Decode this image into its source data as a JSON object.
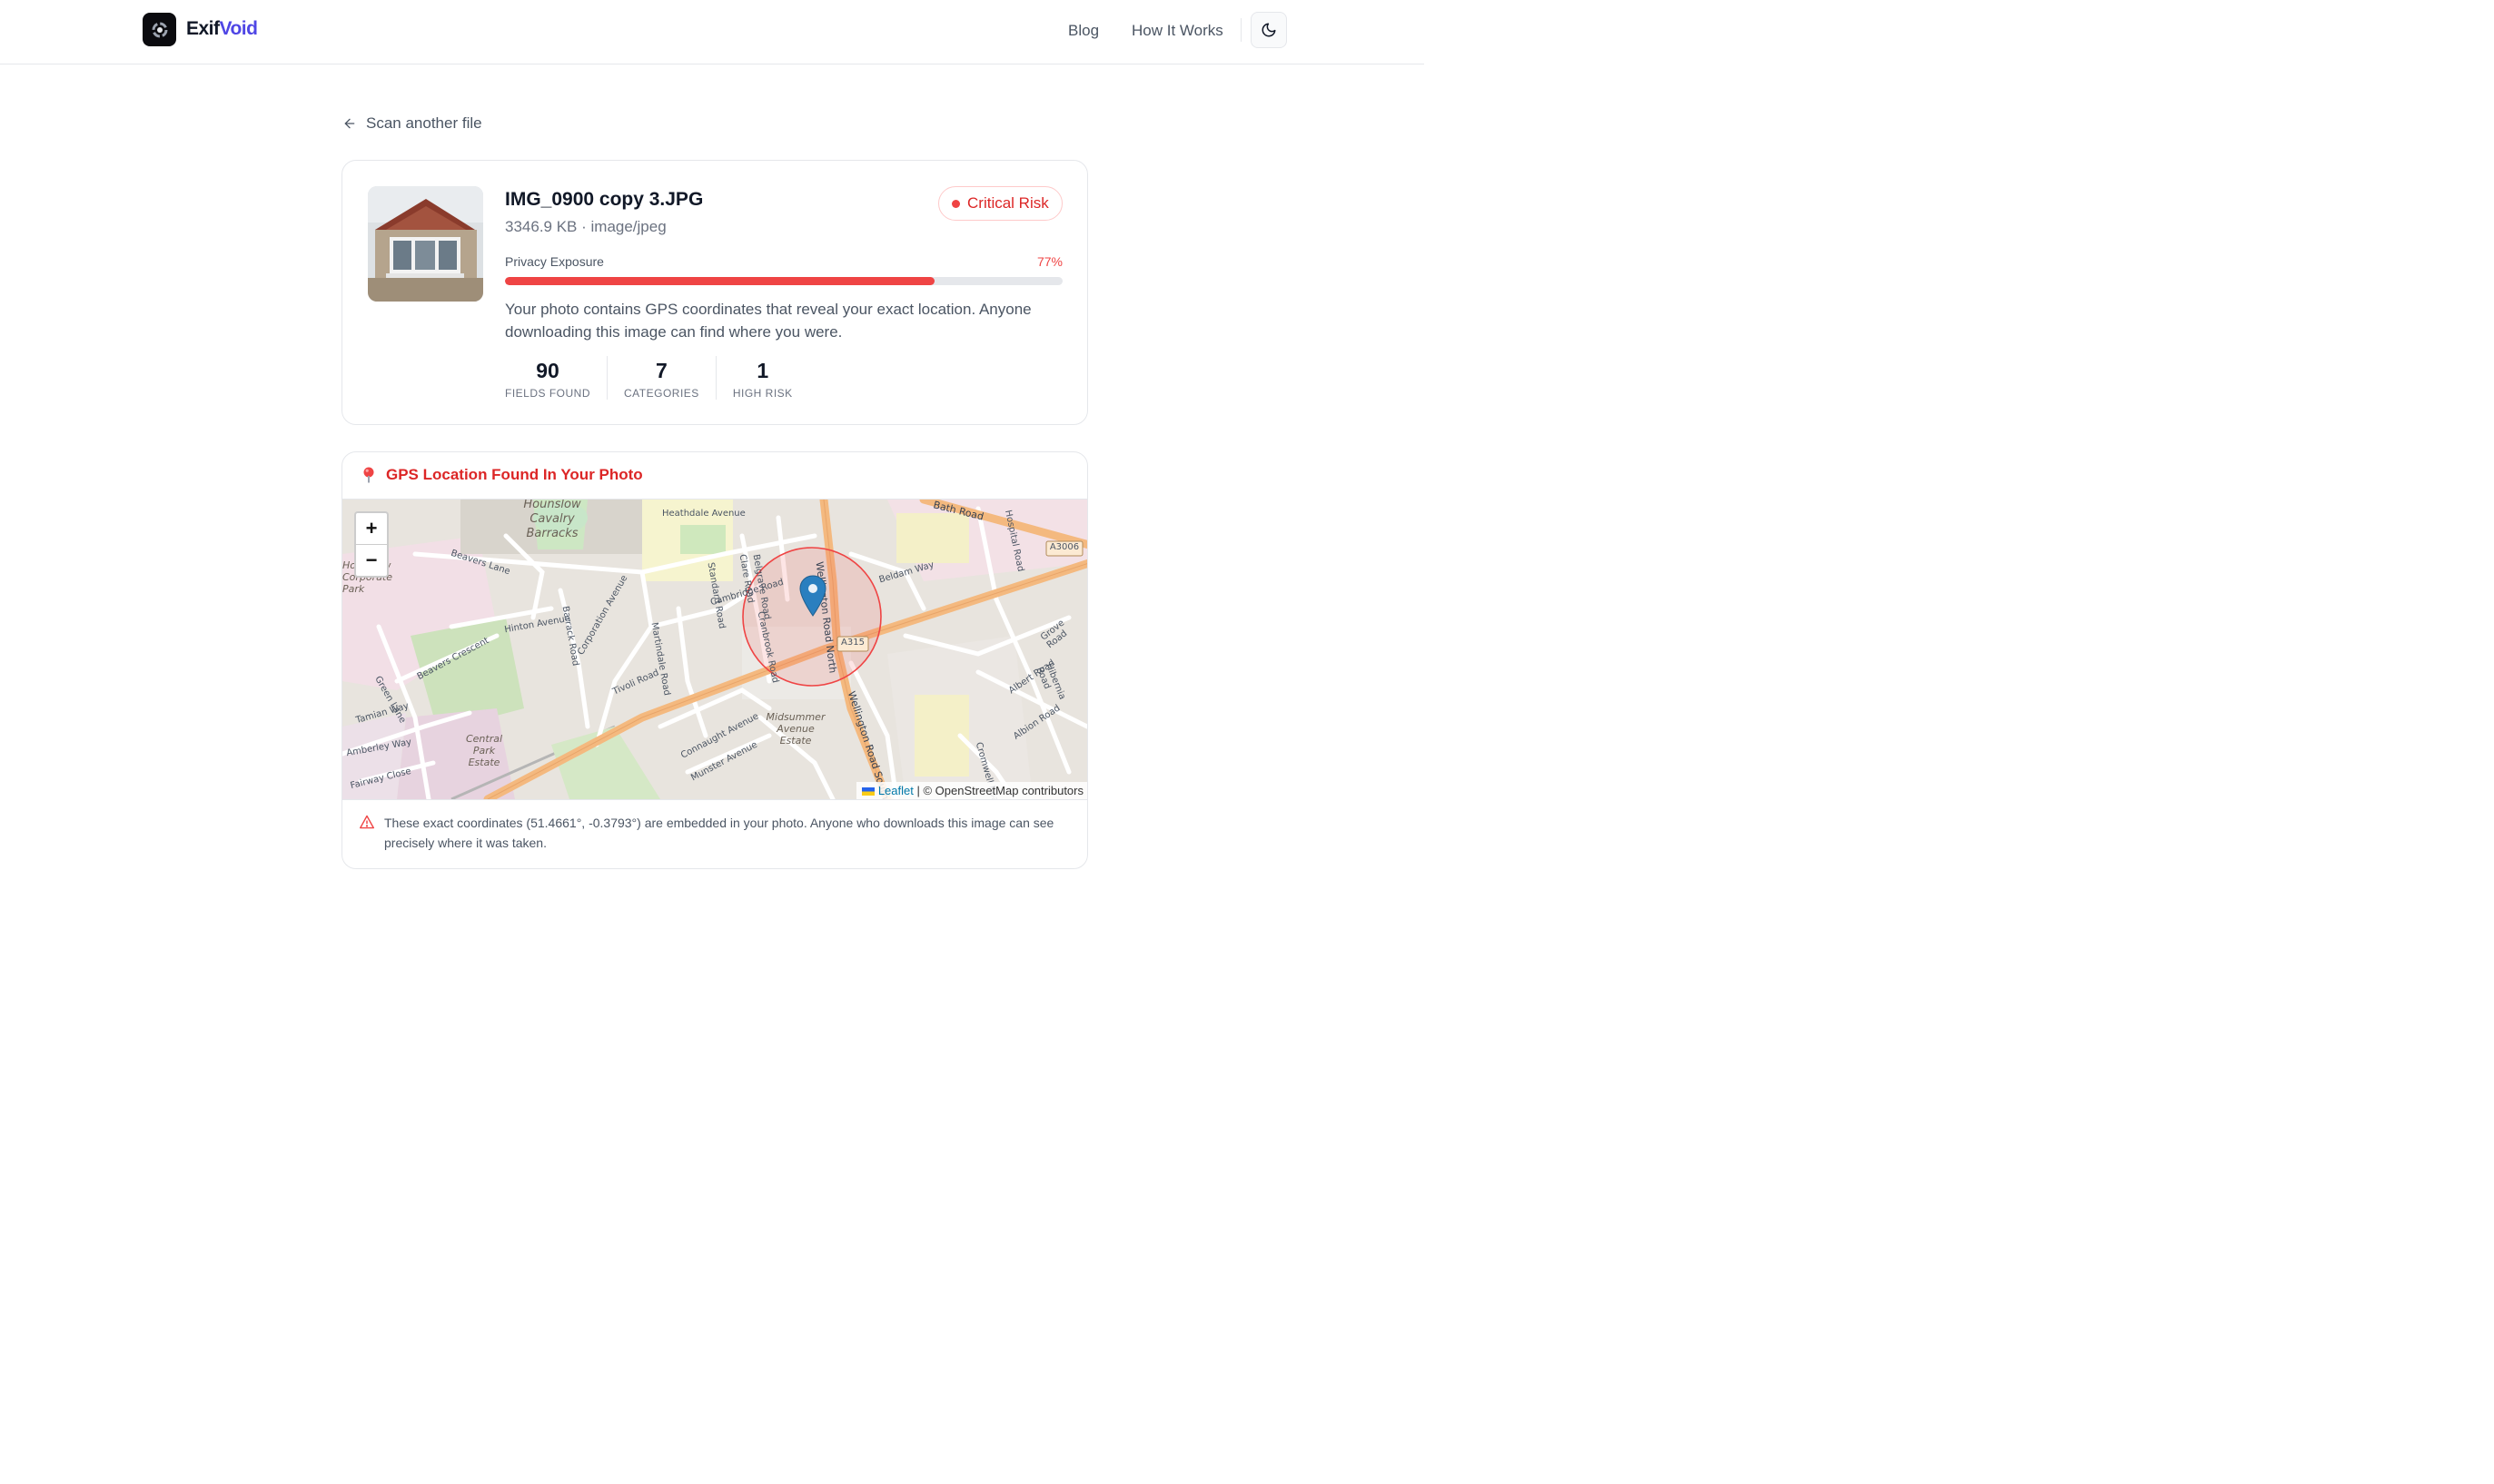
{
  "header": {
    "logo_icon": "exifvoid-logo",
    "brand_prefix": "Exif",
    "brand_suffix": "Void",
    "nav": [
      "Blog",
      "How It Works"
    ],
    "theme_icon": "moon-icon"
  },
  "back_link": {
    "icon": "arrow-left-icon",
    "label": "Scan another file"
  },
  "file_card": {
    "filename": "IMG_0900 copy 3.JPG",
    "meta": "3346.9 KB · image/jpeg",
    "risk_label": "Critical Risk",
    "exposure_label": "Privacy Exposure",
    "exposure_pct_text": "77%",
    "exposure_value": 0.77,
    "description": "Your photo contains GPS coordinates that reveal your exact location. Anyone downloading this image can find where you were.",
    "stats": [
      {
        "value": "90",
        "label": "FIELDS FOUND"
      },
      {
        "value": "7",
        "label": "CATEGORIES"
      },
      {
        "value": "1",
        "label": "HIGH RISK"
      }
    ]
  },
  "gps": {
    "icon": "map-pin-icon",
    "title": "GPS Location Found In Your Photo",
    "map_labels": {
      "roads": [
        "Heathdale Avenue",
        "Bath Road",
        "Hospital Road",
        "Beavers Lane",
        "Standard Road",
        "Clare Road",
        "Belgrave Road",
        "Wellington Road North",
        "Cambridge Road",
        "Beldam Way",
        "Hinton Avenue",
        "Barrack Road",
        "Corporation Avenue",
        "Martindale Road",
        "Cranbrook Road",
        "Grove Road",
        "Beavers Crescent",
        "Green Lane",
        "Tivoli Road",
        "Tamian Way",
        "Wellington Road South",
        "Albert Road",
        "Hibernia Road",
        "Albion Road",
        "Connaught Avenue",
        "Munster Avenue",
        "Amberley Way",
        "Cromwell Road",
        "Fairway Close"
      ],
      "places": [
        "Hounslow Cavalry Barracks",
        "Hounslow Corporate Park",
        "Central Park Estate",
        "Midsummer Avenue Estate"
      ],
      "shields": [
        "A3006",
        "A315"
      ]
    },
    "attribution_leaflet": "Leaflet",
    "attribution_rest": "| © OpenStreetMap contributors",
    "zoom_in": "+",
    "zoom_out": "−",
    "warning_icon": "warning-triangle-icon",
    "warning": "These exact coordinates (51.4661°, -0.3793°) are embedded in your photo. Anyone who downloads this image can see precisely where it was taken."
  },
  "colors": {
    "accent": "#4f46e5",
    "danger": "#ef4444"
  }
}
